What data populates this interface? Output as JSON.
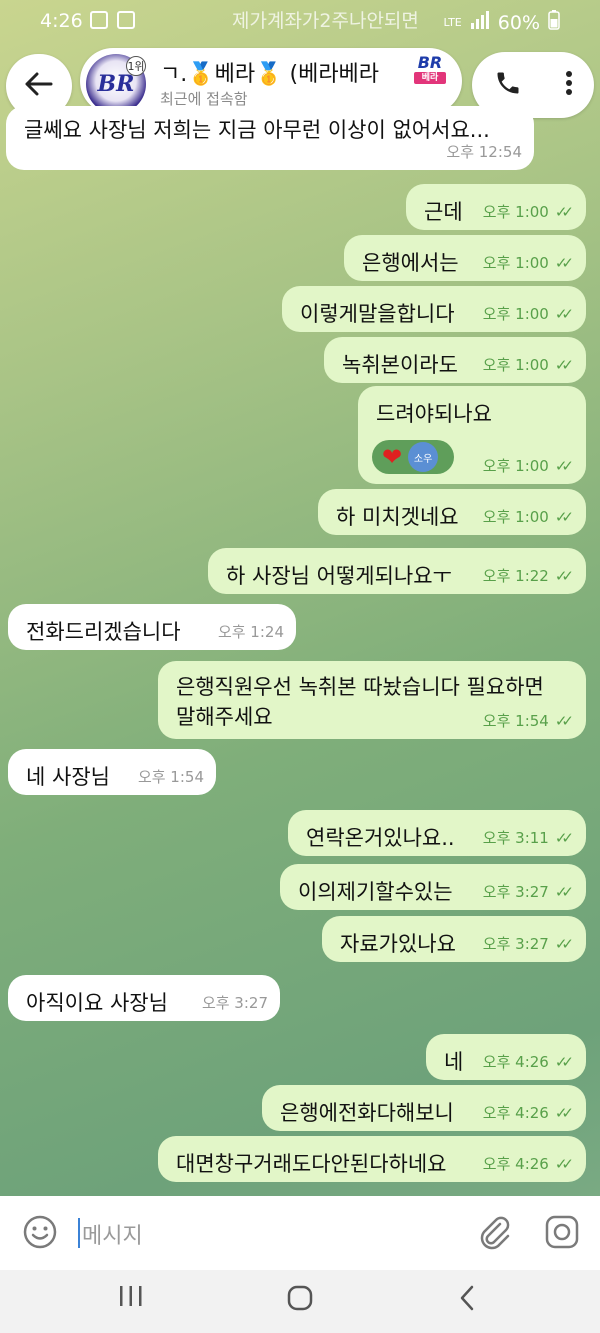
{
  "status": {
    "time": "4:26",
    "network": "LTE",
    "battery": "60%"
  },
  "ghost_text": "제가계좌가2주나안되면",
  "header": {
    "avatar_text": "BR",
    "badge": "1위",
    "title": "ㄱ.🥇베라🥇 (베라베라",
    "logo_text": "BR",
    "logo_sub": "베라",
    "subtitle": "최근에 접속함"
  },
  "messages": [
    {
      "dir": "in",
      "text": "글쎄요 사장님 저희는 지금 아무런 이상이 없어서요...",
      "time": "오후 12:54"
    },
    {
      "dir": "out",
      "text": "근데",
      "time": "오후 1:00"
    },
    {
      "dir": "out",
      "text": "은행에서는",
      "time": "오후 1:00"
    },
    {
      "dir": "out",
      "text": "이렇게말을합니다",
      "time": "오후 1:00"
    },
    {
      "dir": "out",
      "text": "녹취본이라도",
      "time": "오후 1:00"
    },
    {
      "dir": "out",
      "text": "드려야되나요",
      "time": "오후 1:00",
      "reaction": {
        "emoji": "❤",
        "user": "소우"
      }
    },
    {
      "dir": "out",
      "text": "하 미치겟네요",
      "time": "오후 1:00"
    },
    {
      "dir": "out",
      "text": "하 사장님 어떻게되나요ㅜ",
      "time": "오후 1:22"
    },
    {
      "dir": "in",
      "text": "전화드리겠습니다",
      "time": "오후 1:24"
    },
    {
      "dir": "out",
      "text": "은행직원우선 녹취본 따놨습니다 필요하면",
      "text2": "말해주세요",
      "time": "오후 1:54"
    },
    {
      "dir": "in",
      "text": "네 사장님",
      "time": "오후 1:54"
    },
    {
      "dir": "out",
      "text": "연락온거있나요..",
      "time": "오후 3:11"
    },
    {
      "dir": "out",
      "text": "이의제기할수있는",
      "time": "오후 3:27"
    },
    {
      "dir": "out",
      "text": "자료가있나요",
      "time": "오후 3:27"
    },
    {
      "dir": "in",
      "text": "아직이요 사장님",
      "time": "오후 3:27"
    },
    {
      "dir": "out",
      "text": "네",
      "time": "오후 4:26"
    },
    {
      "dir": "out",
      "text": "은행에전화다해보니",
      "time": "오후 4:26"
    },
    {
      "dir": "out",
      "text": "대면창구거래도다안된다하네요",
      "time": "오후 4:26"
    }
  ],
  "input": {
    "placeholder": "메시지"
  },
  "icons": {
    "back": "back-arrow-icon",
    "call": "phone-icon",
    "menu": "more-vertical-icon",
    "emoji": "emoji-icon",
    "attach": "paperclip-icon",
    "camera": "camera-icon"
  }
}
